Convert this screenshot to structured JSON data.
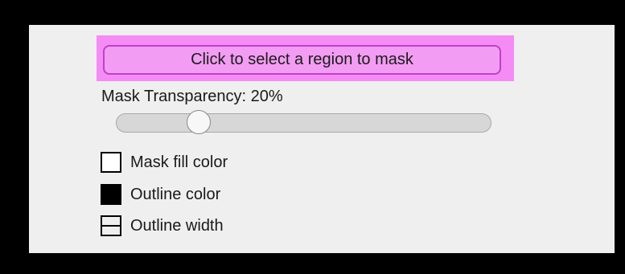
{
  "mask_button": {
    "label": "Click to select a region to mask"
  },
  "transparency": {
    "label": "Mask Transparency: 20%",
    "value_percent": 20
  },
  "options": [
    {
      "label": "Mask fill color",
      "swatch_color": "#ffffff",
      "icon": "white-color-swatch"
    },
    {
      "label": "Outline color",
      "swatch_color": "#000000",
      "icon": "black-color-swatch"
    },
    {
      "label": "Outline width",
      "icon": "line-width-icon"
    }
  ],
  "colors": {
    "background": "#000000",
    "panel": "#efefef",
    "highlight": "#f58cf5",
    "button_fill": "#f39cf3",
    "button_border": "#c040c8"
  }
}
